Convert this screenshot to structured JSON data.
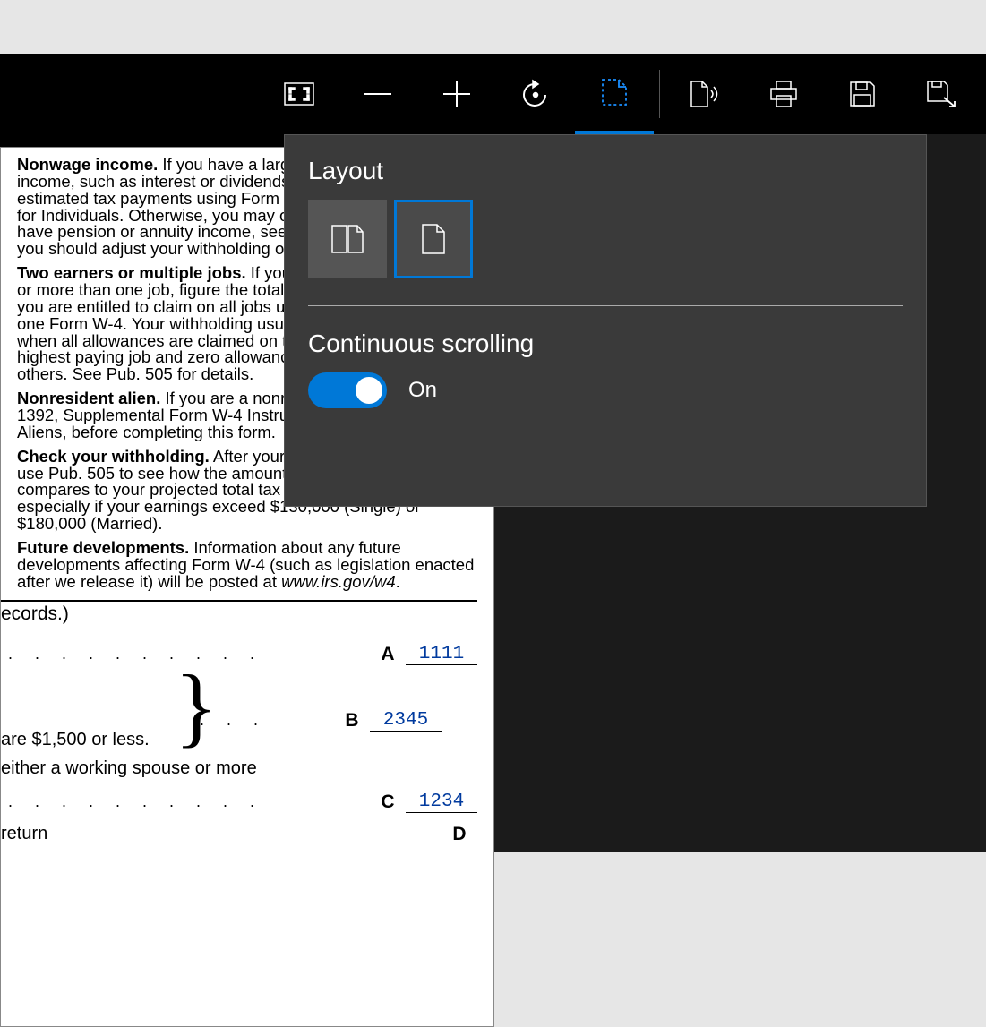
{
  "toolbar": {
    "buttons": [
      {
        "name": "fit-to-width-icon"
      },
      {
        "name": "zoom-out-icon"
      },
      {
        "name": "zoom-in-icon"
      },
      {
        "name": "rotate-icon"
      },
      {
        "name": "layout-icon",
        "active": true
      },
      {
        "name": "read-aloud-icon"
      },
      {
        "name": "print-icon"
      },
      {
        "name": "save-icon"
      },
      {
        "name": "save-as-icon"
      }
    ]
  },
  "popup": {
    "layout_heading": "Layout",
    "options": [
      {
        "name": "two-page-layout",
        "selected": false
      },
      {
        "name": "single-page-layout",
        "selected": true
      }
    ],
    "continuous_heading": "Continuous scrolling",
    "toggle_state": true,
    "toggle_label": "On"
  },
  "document": {
    "paragraphs": {
      "p1_bold": "Nonwage income.",
      "p1_rest": " If you have a large amount of nonwage income, such as interest or dividends, consider making estimated tax payments using Form 1040-ES, Estimated Tax for Individuals. Otherwise, you may owe additional tax. If you have pension or annuity income, see Pub. 505 to find out if you should adjust your withholding on Form W-4 or W-4P.",
      "p2_bold": "Two earners or multiple jobs.",
      "p2_rest": " If you have a working spouse or more than one job, figure the total number of allowances you are entitled to claim on all jobs using worksheets from only one Form W-4. Your withholding usually will be most accurate when all allowances are claimed on the Form W-4 for the highest paying job and zero allowances are claimed on the others. See Pub. 505 for details.",
      "p3_bold": "Nonresident alien.",
      "p3_rest": " If you are a nonresident alien, see Notice 1392, Supplemental Form W-4 Instructions for Nonresident Aliens, before completing this form.",
      "p4_bold": "Check your withholding.",
      "p4_rest": " After your Form W-4 takes effect, use Pub. 505 to see how the amount you are having withheld compares to your projected total tax for 2017. See Pub. 505, especially if your earnings exceed $130,000 (Single) or $180,000 (Married).",
      "p5_bold": "Future developments.",
      "p5_rest_a": " Information about any future developments affecting Form W-4 (such as legislation enacted after we release it) will be posted at ",
      "p5_italic": "www.irs.gov/w4",
      "p5_rest_b": "."
    },
    "records_line": "ecords.)",
    "worksheet": {
      "rowA": {
        "letter": "A",
        "value": "1111"
      },
      "rowB": {
        "letter": "B",
        "value": "2345",
        "dots": ".   .   ."
      },
      "rowC": {
        "letter": "C",
        "value": "1234"
      },
      "rowD": {
        "letter": "D"
      },
      "sub1": " are $1,500 or less.",
      "sub2": "either a working spouse or more",
      "sub3": "return",
      "dots_long": ".   .   .   .   .   .   .   .   .   ."
    }
  }
}
